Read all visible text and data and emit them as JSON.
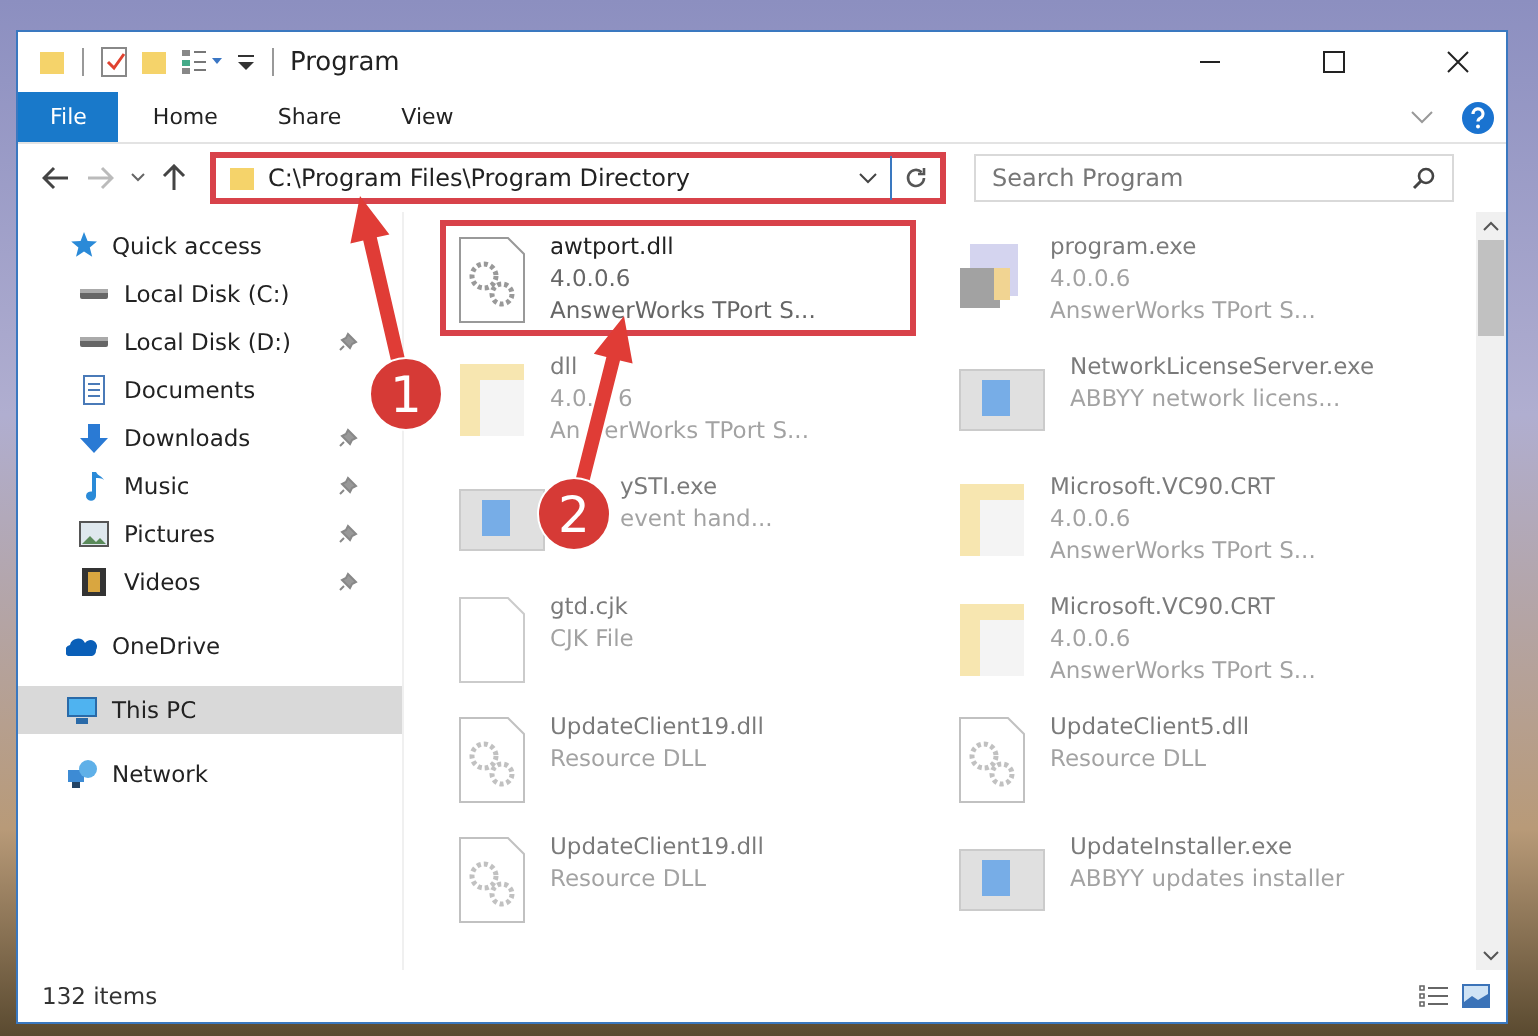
{
  "window": {
    "title": "Program"
  },
  "ribbon": {
    "tabs": [
      {
        "label": "File",
        "selected": true
      },
      {
        "label": "Home",
        "selected": false
      },
      {
        "label": "Share",
        "selected": false
      },
      {
        "label": "View",
        "selected": false
      }
    ]
  },
  "address": {
    "path": "C:\\Program Files\\Program Directory",
    "highlighted": true
  },
  "search": {
    "placeholder": "Search Program"
  },
  "sidebar": {
    "items": [
      {
        "label": "Quick access",
        "selected": false,
        "children": [
          {
            "label": "Local Disk (C:)",
            "pinned": false,
            "selected": false
          },
          {
            "label": "Local Disk (D:)",
            "pinned": true,
            "selected": false
          },
          {
            "label": "Documents",
            "pinned": false,
            "selected": false
          },
          {
            "label": "Downloads",
            "pinned": true,
            "selected": false
          },
          {
            "label": "Music",
            "pinned": true,
            "selected": false
          },
          {
            "label": "Pictures",
            "pinned": true,
            "selected": false
          },
          {
            "label": "Videos",
            "pinned": true,
            "selected": false
          }
        ]
      },
      {
        "label": "OneDrive",
        "selected": false
      },
      {
        "label": "This PC",
        "selected": true
      },
      {
        "label": "Network",
        "selected": false
      }
    ]
  },
  "files": [
    {
      "kind": "dll",
      "name": [
        "awtport.dll"
      ],
      "lines": [
        [
          "4.0.0.6"
        ],
        [
          "AnswerWorks TPort S..."
        ]
      ],
      "highlighted": true
    },
    {
      "kind": "app",
      "name": [
        "program.exe"
      ],
      "lines": [
        [
          "4.0.0.6"
        ],
        [
          "AnswerWorks TPort S..."
        ]
      ],
      "highlighted": false
    },
    {
      "kind": "folder",
      "name": [
        "dll"
      ],
      "lines": [
        [
          "4.0.",
          "6"
        ],
        [
          "An",
          "erWorks TPort S..."
        ]
      ],
      "highlighted": false
    },
    {
      "kind": "window",
      "name": [
        "NetworkLicenseServer.exe"
      ],
      "lines": [
        [
          "ABBYY network licens..."
        ]
      ],
      "highlighted": false
    },
    {
      "kind": "window",
      "name": [
        "ySTI.exe"
      ],
      "lines": [
        [
          "event hand..."
        ]
      ],
      "highlighted": false
    },
    {
      "kind": "folder",
      "name": [
        "Microsoft.VC90.CRT"
      ],
      "lines": [
        [
          "4.0.0.6"
        ],
        [
          "AnswerWorks TPort S..."
        ]
      ],
      "highlighted": false
    },
    {
      "kind": "file",
      "name": [
        "gtd.cjk"
      ],
      "lines": [
        [
          "CJK File"
        ]
      ],
      "highlighted": false
    },
    {
      "kind": "folder",
      "name": [
        "Microsoft.VC90.CRT"
      ],
      "lines": [
        [
          "4.0.0.6"
        ],
        [
          "AnswerWorks TPort S..."
        ]
      ],
      "highlighted": false
    },
    {
      "kind": "dll",
      "name": [
        "UpdateClient19.dll"
      ],
      "lines": [
        [
          "Resource DLL"
        ]
      ],
      "highlighted": false
    },
    {
      "kind": "dll",
      "name": [
        "UpdateClient5.dll"
      ],
      "lines": [
        [
          "Resource DLL"
        ]
      ],
      "highlighted": false
    },
    {
      "kind": "dll",
      "name": [
        "UpdateClient19.dll"
      ],
      "lines": [
        [
          "Resource DLL"
        ]
      ],
      "highlighted": false
    },
    {
      "kind": "window",
      "name": [
        "UpdateInstaller.exe"
      ],
      "lines": [
        [
          "ABBYY updates installer"
        ]
      ],
      "highlighted": false
    }
  ],
  "status_bar": {
    "count": "132 items"
  },
  "annotations": [
    {
      "label": "1"
    },
    {
      "label": "2"
    }
  ]
}
